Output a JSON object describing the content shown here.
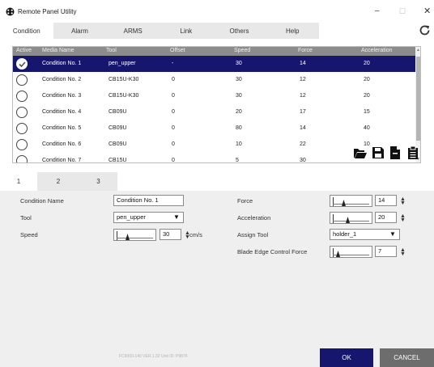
{
  "window": {
    "title": "Remote Panel Utility",
    "minimize_glyph": "–",
    "maximize_glyph": "☐",
    "close_glyph": "✕"
  },
  "tabs": [
    {
      "label": "Condition",
      "active": true
    },
    {
      "label": "Alarm",
      "active": false
    },
    {
      "label": "ARMS",
      "active": false
    },
    {
      "label": "Link",
      "active": false
    },
    {
      "label": "Others",
      "active": false
    },
    {
      "label": "Help",
      "active": false
    }
  ],
  "table": {
    "columns": [
      "Active",
      "Media Name",
      "Tool",
      "Offset",
      "Speed",
      "Force",
      "Acceleration"
    ],
    "rows": [
      {
        "active": true,
        "media": "Condition No. 1",
        "tool": "pen_upper",
        "offset": "-",
        "speed": "30",
        "force": "14",
        "accel": "20"
      },
      {
        "active": false,
        "media": "Condition No. 2",
        "tool": "CB15U-K30",
        "offset": "0",
        "speed": "30",
        "force": "12",
        "accel": "20"
      },
      {
        "active": false,
        "media": "Condition No. 3",
        "tool": "CB15U-K30",
        "offset": "0",
        "speed": "30",
        "force": "12",
        "accel": "20"
      },
      {
        "active": false,
        "media": "Condition No. 4",
        "tool": "CB09U",
        "offset": "0",
        "speed": "20",
        "force": "17",
        "accel": "15"
      },
      {
        "active": false,
        "media": "Condition No. 5",
        "tool": "CB09U",
        "offset": "0",
        "speed": "80",
        "force": "14",
        "accel": "40"
      },
      {
        "active": false,
        "media": "Condition No. 6",
        "tool": "CB09U",
        "offset": "0",
        "speed": "10",
        "force": "22",
        "accel": "10"
      },
      {
        "active": false,
        "media": "Condition No. 7",
        "tool": "CB15U",
        "offset": "0",
        "speed": "5",
        "force": "30",
        "accel": ""
      }
    ]
  },
  "subtabs": [
    {
      "label": "1",
      "active": true
    },
    {
      "label": "2",
      "active": false
    },
    {
      "label": "3",
      "active": false
    }
  ],
  "form": {
    "condition_name_label": "Condition Name",
    "condition_name_value": "Condition No. 1",
    "tool_label": "Tool",
    "tool_value": "pen_upper",
    "speed_label": "Speed",
    "speed_value": "30",
    "speed_unit": "cm/s",
    "force_label": "Force",
    "force_value": "14",
    "acceleration_label": "Acceleration",
    "acceleration_value": "20",
    "assign_tool_label": "Assign Tool",
    "assign_tool_value": "holder_1",
    "blade_edge_label": "Blade Edge Control Force",
    "blade_edge_value": "7"
  },
  "footer": {
    "version_text": "FC9000-140 VER.1.32 Unit ID: P9876",
    "ok_label": "OK",
    "cancel_label": "CANCEL"
  },
  "colors": {
    "selected_row": "#16166e",
    "ok_button": "#16166e",
    "cancel_button": "#6d6d6d",
    "header_bg": "#8c8c8c"
  },
  "icons": {
    "app": "remote-panel-app-icon",
    "refresh": "refresh-icon",
    "open": "open-folder-icon",
    "save": "save-icon",
    "export": "export-file-icon",
    "clipboard": "clipboard-icon"
  }
}
